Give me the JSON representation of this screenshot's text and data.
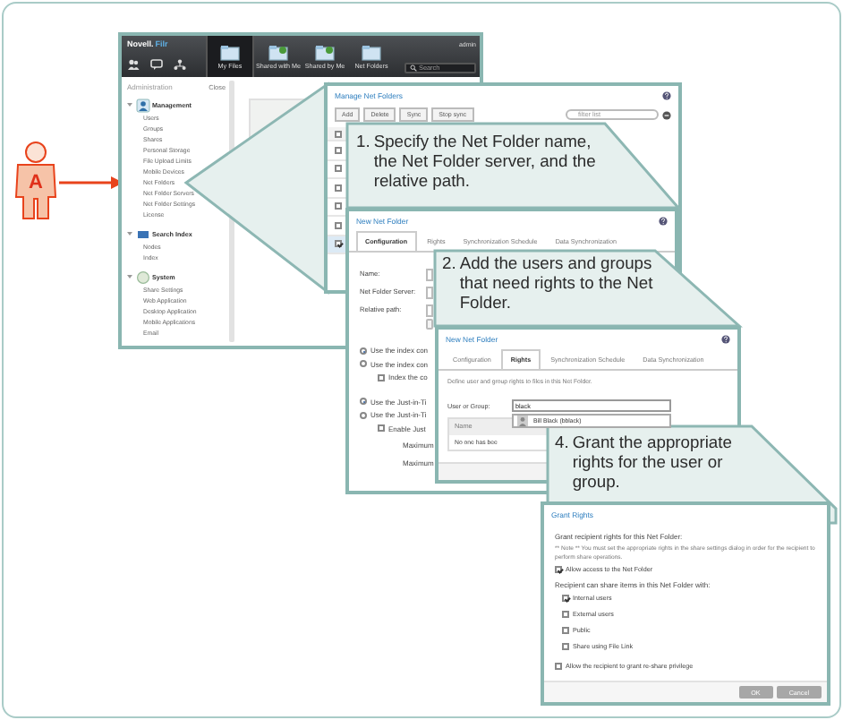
{
  "figure": {
    "badge": "A"
  },
  "admin_window": {
    "brand": "Novell.",
    "product": "Filr",
    "user": "admin",
    "search_placeholder": "Search",
    "nav": [
      {
        "label": "My Files",
        "selected": true
      },
      {
        "label": "Shared with Me",
        "selected": false
      },
      {
        "label": "Shared by Me",
        "selected": false
      },
      {
        "label": "Net Folders",
        "selected": false
      }
    ],
    "sidebar_title": "Administration",
    "close": "Close",
    "sections": [
      {
        "label": "Management",
        "items": [
          "Users",
          "Groups",
          "Shares",
          "Personal Storage",
          "File Upload Limits",
          "Mobile Devices",
          "Net Folders",
          "Net Folder Servers",
          "Net Folder Settings",
          "License"
        ]
      },
      {
        "label": "Search Index",
        "items": [
          "Nodes",
          "Index"
        ]
      },
      {
        "label": "System",
        "items": [
          "Share Settings",
          "Web Application",
          "Desktop Application",
          "Mobile Applications",
          "Email"
        ]
      }
    ]
  },
  "manage_window": {
    "title": "Manage Net Folders",
    "buttons": [
      "Add",
      "Delete",
      "Sync",
      "Stop sync"
    ],
    "filter_placeholder": "filter list",
    "select_all": {
      "checked": false
    },
    "rows": [
      {
        "checked": false,
        "selected": false
      },
      {
        "checked": false,
        "selected": false
      },
      {
        "checked": false,
        "selected": false
      },
      {
        "checked": false,
        "selected": false
      },
      {
        "checked": false,
        "selected": false
      },
      {
        "checked": true,
        "selected": true
      }
    ]
  },
  "callouts": [
    {
      "number": "1.",
      "text": "Specify the Net Folder name, the Net Folder server, and the relative path."
    },
    {
      "number": "2.",
      "text": "Add the users and groups that need rights to the Net Folder."
    },
    {
      "number": "4.",
      "text": "Grant the appropriate rights for the user or group."
    }
  ],
  "new_folder_window": {
    "title": "New Net Folder",
    "tabs": [
      {
        "label": "Configuration",
        "selected": true
      },
      {
        "label": "Rights",
        "selected": false
      },
      {
        "label": "Synchronization Schedule",
        "selected": false
      },
      {
        "label": "Data Synchronization",
        "selected": false
      }
    ],
    "fields": [
      "Name:",
      "Net Folder Server:",
      "Relative path:"
    ],
    "options": [
      {
        "label": "Use the index con",
        "checked": true
      },
      {
        "label": "Use the index con",
        "checked": false,
        "children": [
          {
            "label": "Index the co",
            "checked": false
          }
        ]
      },
      {
        "label": "Use the Just-in-Ti",
        "checked": true
      },
      {
        "label": "Use the Just-in-Ti",
        "checked": false,
        "children": [
          {
            "label": "Enable Just",
            "checked": false,
            "fields": [
              "Maximum",
              "Maximum"
            ]
          }
        ]
      }
    ]
  },
  "rights_window": {
    "title": "New Net Folder",
    "tabs": [
      {
        "label": "Configuration",
        "selected": false
      },
      {
        "label": "Rights",
        "selected": true
      },
      {
        "label": "Synchronization Schedule",
        "selected": false
      },
      {
        "label": "Data Synchronization",
        "selected": false
      }
    ],
    "intro": "Define user and group rights to files in this Net Folder.",
    "user_label": "User or Group:",
    "user_value": "black",
    "suggestion": "Bill Black (bblack)",
    "columns": [
      "Name"
    ],
    "empty_text": "No one has bee"
  },
  "grant_window": {
    "title": "Grant Rights",
    "intro": "Grant recipient rights for this Net Folder:",
    "note": "** Note ** You must set the appropriate rights in the share settings dialog in order for the recipient to perform share operations.",
    "allow_access": {
      "label": "Allow access to the Net Folder",
      "checked": true
    },
    "share_heading": "Recipient can share items in this Net Folder with:",
    "share_options": [
      {
        "label": "Internal users",
        "checked": true
      },
      {
        "label": "External users",
        "checked": false
      },
      {
        "label": "Public",
        "checked": false
      },
      {
        "label": "Share using File Link",
        "checked": false
      }
    ],
    "reshare": {
      "label": "Allow the recipient to grant re-share privilege",
      "checked": false
    },
    "buttons": [
      "OK",
      "Cancel"
    ]
  }
}
